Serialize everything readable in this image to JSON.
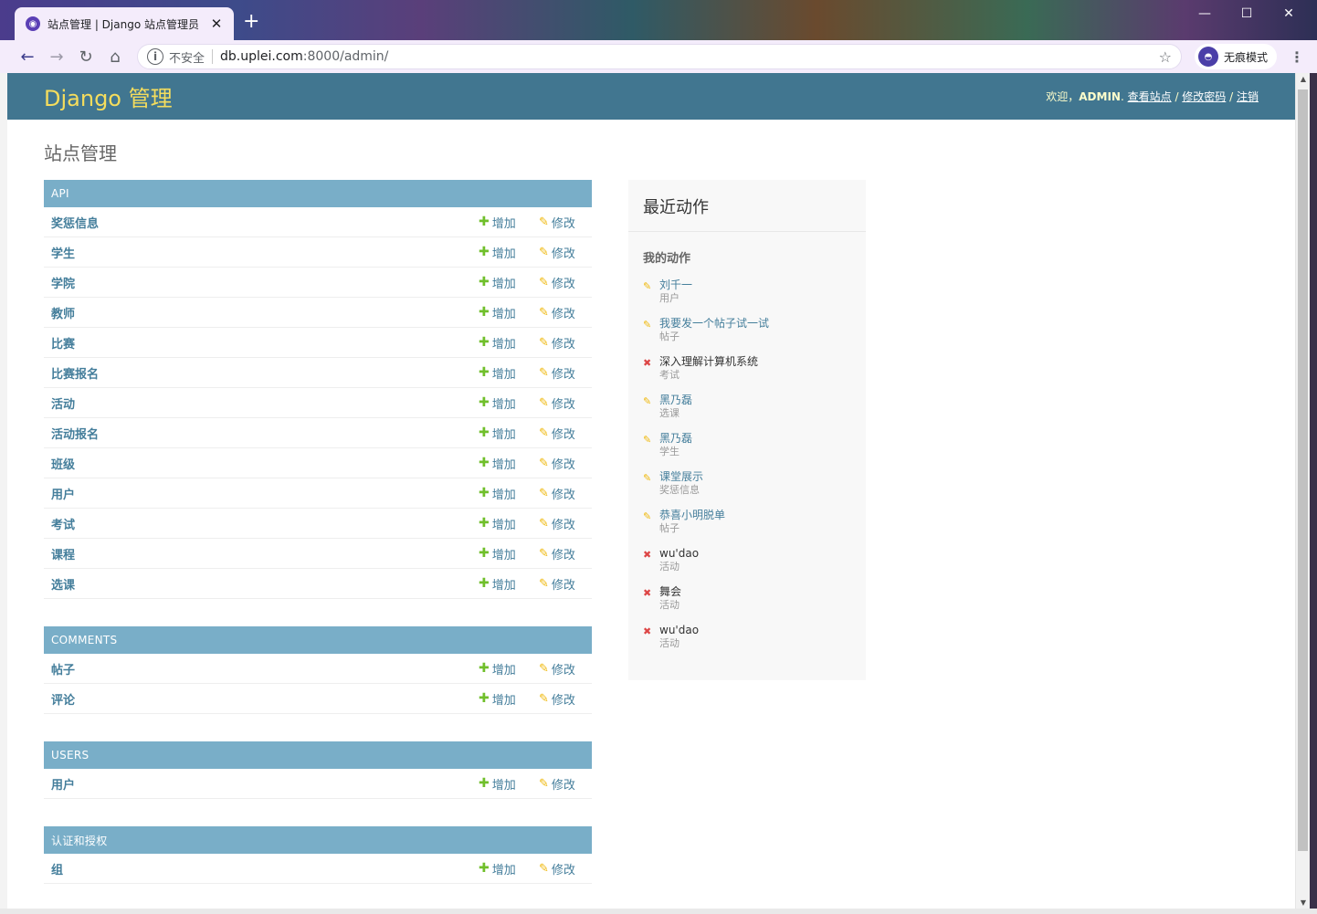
{
  "browser": {
    "tab_title": "站点管理 | Django 站点管理员",
    "tab_close": "✕",
    "new_tab": "+",
    "window": {
      "minimize": "—",
      "maximize": "☐",
      "close": "✕"
    },
    "security_label": "不安全",
    "url_host": "db.uplei.com",
    "url_rest": ":8000/admin/",
    "incognito_label": "无痕模式"
  },
  "header": {
    "brand": "Django 管理",
    "welcome": "欢迎，",
    "username": "ADMIN",
    "links": [
      "查看站点",
      "修改密码",
      "注销"
    ]
  },
  "page_title": "站点管理",
  "labels": {
    "add": "增加",
    "change": "修改"
  },
  "modules": [
    {
      "caption": "API",
      "models": [
        "奖惩信息",
        "学生",
        "学院",
        "教师",
        "比赛",
        "比赛报名",
        "活动",
        "活动报名",
        "班级",
        "用户",
        "考试",
        "课程",
        "选课"
      ]
    },
    {
      "caption": "COMMENTS",
      "models": [
        "帖子",
        "评论"
      ]
    },
    {
      "caption": "USERS",
      "models": [
        "用户"
      ]
    },
    {
      "caption": "认证和授权",
      "models": [
        "组"
      ]
    }
  ],
  "recent_actions": {
    "title": "最近动作",
    "subtitle": "我的动作",
    "items": [
      {
        "name": "刘千一",
        "type": "用户",
        "action": "change"
      },
      {
        "name": "我要发一个帖子试一试",
        "type": "帖子",
        "action": "change"
      },
      {
        "name": "深入理解计算机系统",
        "type": "考试",
        "action": "delete"
      },
      {
        "name": "黑乃磊",
        "type": "选课",
        "action": "change"
      },
      {
        "name": "黑乃磊",
        "type": "学生",
        "action": "change"
      },
      {
        "name": "课堂展示",
        "type": "奖惩信息",
        "action": "change"
      },
      {
        "name": "恭喜小明脱单",
        "type": "帖子",
        "action": "change"
      },
      {
        "name": "wu'dao",
        "type": "活动",
        "action": "delete"
      },
      {
        "name": "舞会",
        "type": "活动",
        "action": "delete"
      },
      {
        "name": "wu'dao",
        "type": "活动",
        "action": "delete"
      }
    ]
  },
  "colors": {
    "header_bg": "#417690",
    "brand": "#f5dd5d",
    "caption_bg": "#79aec8",
    "link": "#447e9b",
    "add_icon": "#70bf2b",
    "change_icon": "#efb80b",
    "delete_icon": "#dd4646"
  }
}
